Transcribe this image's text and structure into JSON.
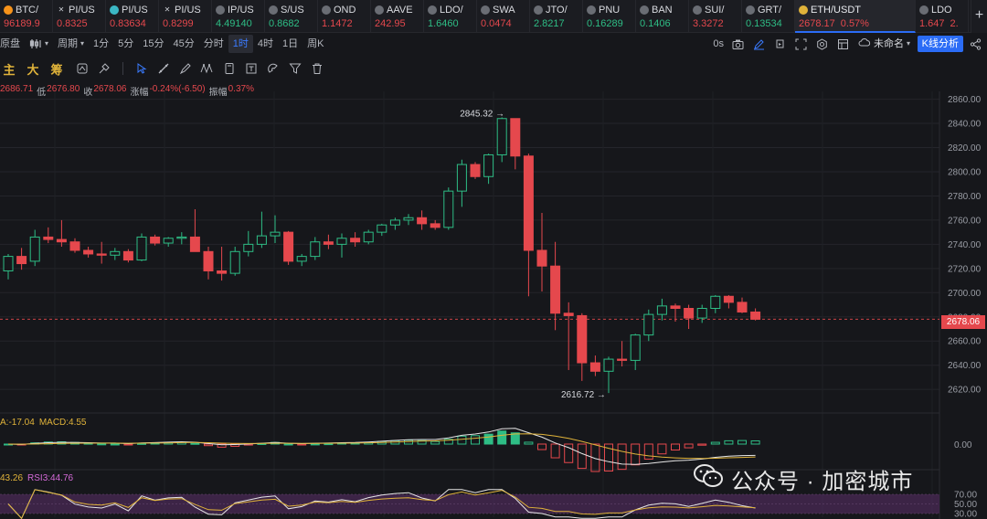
{
  "tickers": [
    {
      "symbol": "BTC/",
      "price": "96189.9",
      "dir": "down",
      "icon": "bitcoin-icon",
      "icon_color": "#f7931a"
    },
    {
      "symbol": "PI/US",
      "price": "0.8325",
      "dir": "down",
      "icon": "close-icon",
      "icon_color": "#c9ccd3"
    },
    {
      "symbol": "PI/US",
      "price": "0.83634",
      "dir": "down",
      "icon": "coin-icon",
      "icon_color": "#3bb7c4"
    },
    {
      "symbol": "PI/US",
      "price": "0.8299",
      "dir": "down",
      "icon": "close-icon",
      "icon_color": "#c9ccd3"
    },
    {
      "symbol": "IP/US",
      "price": "4.49140",
      "dir": "up",
      "icon": "coin-icon",
      "icon_color": "#6a6d74"
    },
    {
      "symbol": "S/US",
      "price": "0.8682",
      "dir": "up",
      "icon": "coin-icon",
      "icon_color": "#6a6d74"
    },
    {
      "symbol": "OND",
      "price": "1.1472",
      "dir": "down",
      "icon": "coin-icon",
      "icon_color": "#6a6d74"
    },
    {
      "symbol": "AAVE",
      "price": "242.95",
      "dir": "down",
      "icon": "coin-icon",
      "icon_color": "#6a6d74"
    },
    {
      "symbol": "LDO/",
      "price": "1.6460",
      "dir": "up",
      "icon": "coin-icon",
      "icon_color": "#6a6d74"
    },
    {
      "symbol": "SWA",
      "price": "0.0474",
      "dir": "down",
      "icon": "coin-icon",
      "icon_color": "#6a6d74"
    },
    {
      "symbol": "JTO/",
      "price": "2.8217",
      "dir": "up",
      "icon": "coin-icon",
      "icon_color": "#6a6d74"
    },
    {
      "symbol": "PNU",
      "price": "0.16289",
      "dir": "up",
      "icon": "coin-icon",
      "icon_color": "#6a6d74"
    },
    {
      "symbol": "BAN",
      "price": "0.1406",
      "dir": "up",
      "icon": "coin-icon",
      "icon_color": "#6a6d74"
    },
    {
      "symbol": "SUI/",
      "price": "3.3272",
      "dir": "down",
      "icon": "coin-icon",
      "icon_color": "#6a6d74"
    },
    {
      "symbol": "GRT/",
      "price": "0.13534",
      "dir": "up",
      "icon": "coin-icon",
      "icon_color": "#6a6d74"
    },
    {
      "symbol": "ETH/USDT",
      "price": "2678.17",
      "change": "0.57%",
      "dir": "down",
      "icon": "ethereum-icon",
      "icon_color": "#e0b33a",
      "active": true
    },
    {
      "symbol": "LDO",
      "price": "1.647",
      "change": "2.",
      "dir": "down",
      "icon": "coin-icon",
      "icon_color": "#6a6d74"
    }
  ],
  "toolbar": {
    "left_label": "原盘",
    "period_label": "周期",
    "intervals": [
      "1分",
      "5分",
      "15分",
      "45分",
      "分时",
      "1时",
      "4时",
      "1日",
      "周K"
    ],
    "active_interval": "1时",
    "countdown": "0s",
    "layout_name": "未命名",
    "kline_analysis": "K线分析"
  },
  "indicator_tabs": [
    "主",
    "大",
    "筹"
  ],
  "ohlc": {
    "high_val": "2686.71",
    "low_label": "低",
    "low_val": "2676.80",
    "close_label": "收",
    "close_val": "2678.06",
    "change_label": "涨幅",
    "change_val": "-0.24%(-6.50)",
    "amp_label": "振幅",
    "amp_val": "0.37%"
  },
  "price_axis": [
    "2860.00",
    "2840.00",
    "2820.00",
    "2800.00",
    "2780.00",
    "2760.00",
    "2740.00",
    "2720.00",
    "2700.00",
    "2680.00",
    "2660.00",
    "2640.00",
    "2620.00"
  ],
  "current_price": "2678.06",
  "high_marker": "2845.32",
  "low_marker": "2616.72",
  "macd": {
    "label1": "A:-17.04",
    "label2": "MACD:4.55",
    "axis_zero": "0.00"
  },
  "rsi": {
    "label1": "43.26",
    "label2": "RSI3:44.76",
    "axis": [
      "70.00",
      "50.00",
      "30.00"
    ]
  },
  "watermark": "公众号 · 加密城市",
  "colors": {
    "up": "#2ebd85",
    "down": "#e5484d",
    "accent": "#2b6cf6",
    "rsi_band": "#4a2a55"
  },
  "chart_data": {
    "type": "candlestick",
    "ylim": [
      2605,
      2868
    ],
    "candles": [
      [
        2718,
        2732,
        2711,
        2730
      ],
      [
        2730,
        2737,
        2719,
        2724
      ],
      [
        2726,
        2752,
        2722,
        2746
      ],
      [
        2746,
        2754,
        2741,
        2744
      ],
      [
        2744,
        2760,
        2738,
        2742
      ],
      [
        2742,
        2745,
        2733,
        2735
      ],
      [
        2735,
        2738,
        2729,
        2732
      ],
      [
        2732,
        2742,
        2724,
        2731
      ],
      [
        2731,
        2737,
        2727,
        2734
      ],
      [
        2734,
        2736,
        2725,
        2727
      ],
      [
        2727,
        2749,
        2726,
        2746
      ],
      [
        2746,
        2748,
        2739,
        2741
      ],
      [
        2741,
        2746,
        2738,
        2745
      ],
      [
        2745,
        2750,
        2740,
        2746
      ],
      [
        2746,
        2769,
        2742,
        2734
      ],
      [
        2734,
        2738,
        2711,
        2718
      ],
      [
        2718,
        2738,
        2710,
        2716
      ],
      [
        2716,
        2738,
        2714,
        2734
      ],
      [
        2734,
        2751,
        2730,
        2740
      ],
      [
        2740,
        2767,
        2737,
        2747
      ],
      [
        2747,
        2764,
        2741,
        2750
      ],
      [
        2750,
        2751,
        2723,
        2726
      ],
      [
        2726,
        2732,
        2722,
        2730
      ],
      [
        2730,
        2746,
        2727,
        2742
      ],
      [
        2742,
        2748,
        2736,
        2740
      ],
      [
        2740,
        2749,
        2729,
        2745
      ],
      [
        2745,
        2750,
        2738,
        2742
      ],
      [
        2742,
        2752,
        2740,
        2750
      ],
      [
        2750,
        2757,
        2747,
        2756
      ],
      [
        2756,
        2762,
        2752,
        2760
      ],
      [
        2760,
        2765,
        2756,
        2762
      ],
      [
        2762,
        2768,
        2752,
        2757
      ],
      [
        2757,
        2760,
        2752,
        2754
      ],
      [
        2754,
        2787,
        2752,
        2784
      ],
      [
        2784,
        2810,
        2771,
        2806
      ],
      [
        2806,
        2808,
        2794,
        2796
      ],
      [
        2796,
        2815,
        2790,
        2814
      ],
      [
        2814,
        2845,
        2808,
        2844
      ],
      [
        2844,
        2838,
        2802,
        2813
      ],
      [
        2813,
        2815,
        2697,
        2735
      ],
      [
        2735,
        2766,
        2701,
        2722
      ],
      [
        2722,
        2742,
        2669,
        2683
      ],
      [
        2683,
        2692,
        2636,
        2681
      ],
      [
        2681,
        2683,
        2627,
        2642
      ],
      [
        2642,
        2648,
        2631,
        2635
      ],
      [
        2635,
        2647,
        2617,
        2645
      ],
      [
        2645,
        2660,
        2639,
        2644
      ],
      [
        2644,
        2666,
        2636,
        2665
      ],
      [
        2665,
        2686,
        2660,
        2682
      ],
      [
        2682,
        2695,
        2677,
        2689
      ],
      [
        2689,
        2691,
        2676,
        2687
      ],
      [
        2687,
        2690,
        2670,
        2679
      ],
      [
        2679,
        2690,
        2675,
        2687
      ],
      [
        2687,
        2698,
        2683,
        2697
      ],
      [
        2697,
        2698,
        2687,
        2692
      ],
      [
        2692,
        2696,
        2683,
        2684
      ],
      [
        2684,
        2687,
        2677,
        2678
      ]
    ]
  }
}
